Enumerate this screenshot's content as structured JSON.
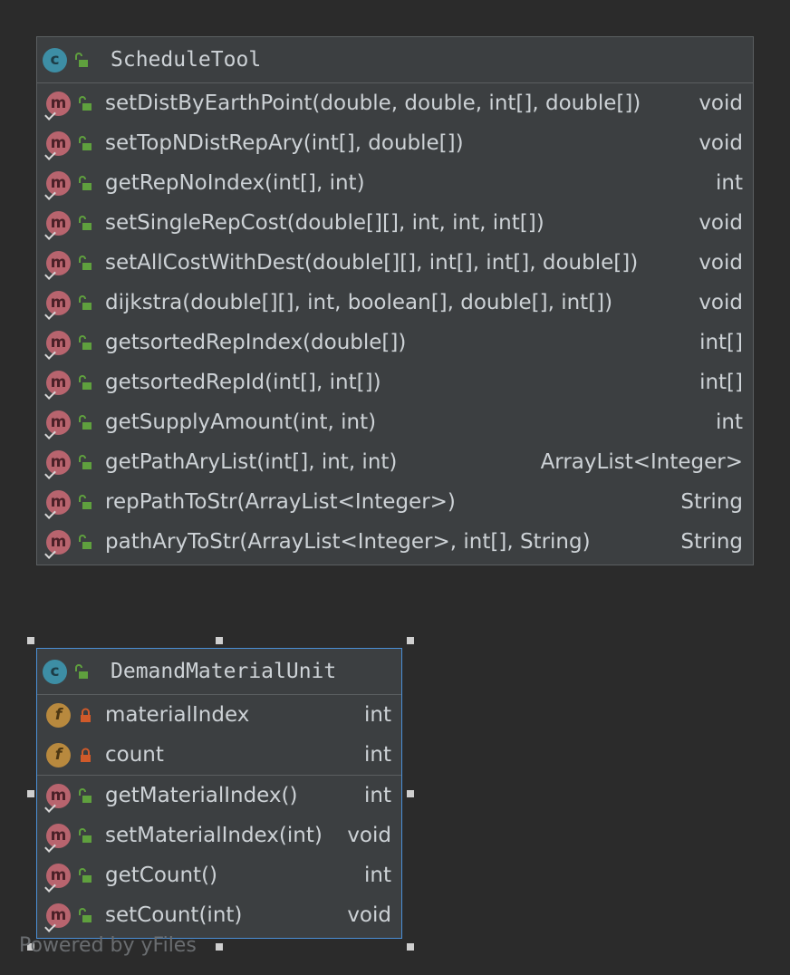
{
  "colors": {
    "background": "#2b2b2b",
    "node_fill": "#3c3f41",
    "node_border": "#5b5f61",
    "selection_border": "#4b8fd6",
    "class_badge": "#3d8ea5",
    "method_badge": "#b8646e",
    "field_badge": "#b8893e",
    "public_icon": "#5fa03e",
    "private_icon": "#d05a2a",
    "text": "#cdd2d6"
  },
  "schedule_tool": {
    "badge": "c",
    "title": "ScheduleTool",
    "methods": [
      {
        "badge": "m",
        "name": "setDistByEarthPoint(double, double, int[], double[])",
        "type": "void"
      },
      {
        "badge": "m",
        "name": "setTopNDistRepAry(int[], double[])",
        "type": "void"
      },
      {
        "badge": "m",
        "name": "getRepNoIndex(int[], int)",
        "type": "int"
      },
      {
        "badge": "m",
        "name": "setSingleRepCost(double[][], int, int, int[])",
        "type": "void"
      },
      {
        "badge": "m",
        "name": "setAllCostWithDest(double[][], int[], int[], double[])",
        "type": "void"
      },
      {
        "badge": "m",
        "name": "dijkstra(double[][], int, boolean[], double[], int[])",
        "type": "void"
      },
      {
        "badge": "m",
        "name": "getsortedRepIndex(double[])",
        "type": "int[]"
      },
      {
        "badge": "m",
        "name": "getsortedRepId(int[], int[])",
        "type": "int[]"
      },
      {
        "badge": "m",
        "name": "getSupplyAmount(int, int)",
        "type": "int"
      },
      {
        "badge": "m",
        "name": "getPathAryList(int[], int, int)",
        "type": "ArrayList<Integer>"
      },
      {
        "badge": "m",
        "name": "repPathToStr(ArrayList<Integer>)",
        "type": "String"
      },
      {
        "badge": "m",
        "name": "pathAryToStr(ArrayList<Integer>, int[], String)",
        "type": "String"
      }
    ]
  },
  "demand_material_unit": {
    "badge": "c",
    "title": "DemandMaterialUnit",
    "fields": [
      {
        "badge": "f",
        "name": "materialIndex",
        "type": "int"
      },
      {
        "badge": "f",
        "name": "count",
        "type": "int"
      }
    ],
    "methods": [
      {
        "badge": "m",
        "name": "getMaterialIndex()",
        "type": "int"
      },
      {
        "badge": "m",
        "name": "setMaterialIndex(int)",
        "type": "void"
      },
      {
        "badge": "m",
        "name": "getCount()",
        "type": "int"
      },
      {
        "badge": "m",
        "name": "setCount(int)",
        "type": "void"
      }
    ]
  },
  "watermark": "Powered by yFiles"
}
